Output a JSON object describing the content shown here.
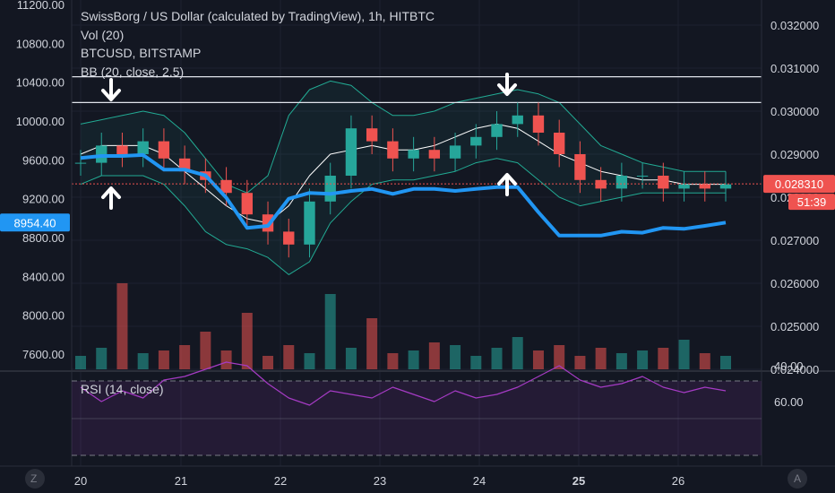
{
  "chart_data": {
    "type": "candlestick",
    "title": "SwissBorg / US Dollar (calculated by TradingView), 1h, HITBTC",
    "legend": [
      "Vol (20)",
      "BTCUSD, BITSTAMP",
      "BB (20, close, 2.5)"
    ],
    "x_ticks": [
      "20",
      "21",
      "22",
      "23",
      "24",
      "25",
      "26"
    ],
    "left_axis": {
      "series": "BTCUSD",
      "ticks": [
        "11200.00",
        "10800.00",
        "10400.00",
        "10000.00",
        "9600.00",
        "9200.00",
        "8800.00",
        "8400.00",
        "8000.00",
        "7600.00"
      ],
      "range": [
        7600,
        11200
      ]
    },
    "right_axis": {
      "series": "CHSB/USD",
      "ticks": [
        "0.032000",
        "0.031000",
        "0.030000",
        "0.029000",
        "0.028000",
        "0.027000",
        "0.026000",
        "0.025000",
        "0.024000"
      ],
      "range": [
        0.024,
        0.032
      ]
    },
    "btc_last_value": "8954.40",
    "price_last_value": "0.028310",
    "countdown": "51:39",
    "price_close": [
      0.0288,
      0.0292,
      0.029,
      0.0293,
      0.0289,
      0.0286,
      0.0284,
      0.0281,
      0.0276,
      0.0272,
      0.0269,
      0.0279,
      0.0285,
      0.0296,
      0.0293,
      0.0289,
      0.0291,
      0.0289,
      0.0292,
      0.0294,
      0.0297,
      0.0299,
      0.0295,
      0.029,
      0.0284,
      0.0282,
      0.0285,
      0.0285,
      0.0282,
      0.0283,
      0.0282,
      0.0283
    ],
    "bb_upper": [
      0.0297,
      0.0298,
      0.0299,
      0.03,
      0.0299,
      0.0295,
      0.0289,
      0.0283,
      0.0281,
      0.0285,
      0.0299,
      0.0305,
      0.0307,
      0.0306,
      0.0302,
      0.0299,
      0.0299,
      0.03,
      0.0302,
      0.0303,
      0.0304,
      0.0305,
      0.0304,
      0.0302,
      0.0297,
      0.0292,
      0.029,
      0.0288,
      0.0287,
      0.0286,
      0.0286,
      0.0286
    ],
    "bb_middle": [
      0.029,
      0.0292,
      0.0292,
      0.0292,
      0.029,
      0.0286,
      0.0282,
      0.0278,
      0.0275,
      0.0274,
      0.0278,
      0.0285,
      0.029,
      0.0291,
      0.0292,
      0.0291,
      0.0291,
      0.0292,
      0.0294,
      0.0296,
      0.0297,
      0.0296,
      0.0293,
      0.029,
      0.0288,
      0.0286,
      0.0285,
      0.0284,
      0.0284,
      0.0283,
      0.0283,
      0.0283
    ],
    "bb_lower": [
      0.0283,
      0.0285,
      0.0285,
      0.0285,
      0.0283,
      0.0278,
      0.0272,
      0.0269,
      0.0268,
      0.0266,
      0.0262,
      0.0265,
      0.0274,
      0.0279,
      0.0283,
      0.0284,
      0.0284,
      0.0285,
      0.0286,
      0.0288,
      0.0289,
      0.0288,
      0.0284,
      0.028,
      0.0278,
      0.0279,
      0.028,
      0.0281,
      0.0281,
      0.0281,
      0.0281,
      0.0281
    ],
    "btc_close": [
      9620,
      9640,
      9640,
      9650,
      9500,
      9500,
      9440,
      9210,
      8900,
      8920,
      9200,
      9260,
      9250,
      9280,
      9300,
      9250,
      9300,
      9300,
      9280,
      9300,
      9320,
      9320,
      9060,
      8820,
      8820,
      8820,
      8860,
      8850,
      8900,
      8890,
      8920,
      8954
    ],
    "volume": [
      0.5,
      0.8,
      3.2,
      0.6,
      0.7,
      0.9,
      1.4,
      0.7,
      2.1,
      0.5,
      0.9,
      0.6,
      2.8,
      0.8,
      1.9,
      0.6,
      0.7,
      1.0,
      0.9,
      0.5,
      0.8,
      1.2,
      0.7,
      0.9,
      0.5,
      0.8,
      0.6,
      0.7,
      0.8,
      1.1,
      0.6,
      0.5
    ],
    "rsi": {
      "label": "RSI (14, close)",
      "ticks": [
        "60.00",
        "40.00"
      ],
      "values": [
        52,
        60,
        54,
        58,
        48,
        46,
        42,
        38,
        40,
        50,
        58,
        62,
        54,
        56,
        58,
        52,
        56,
        60,
        54,
        58,
        56,
        52,
        46,
        40,
        48,
        52,
        50,
        46,
        52,
        55,
        52,
        54
      ]
    },
    "annotations": [
      "arrow-down",
      "arrow-up",
      "arrow-down",
      "arrow-up"
    ],
    "horizontal_levels": [
      0.0308,
      0.0302
    ],
    "colors": {
      "up": "#26a69a",
      "down": "#ef5350",
      "btc_line": "#2196f3",
      "bb_band": "#22ab94",
      "basis": "#ffffff",
      "rsi": "#a53bc4",
      "last_price": "#ef5350",
      "btc_label": "#2196f3"
    }
  },
  "bottom": {
    "left_icon": "Z",
    "right_icon": "A"
  }
}
